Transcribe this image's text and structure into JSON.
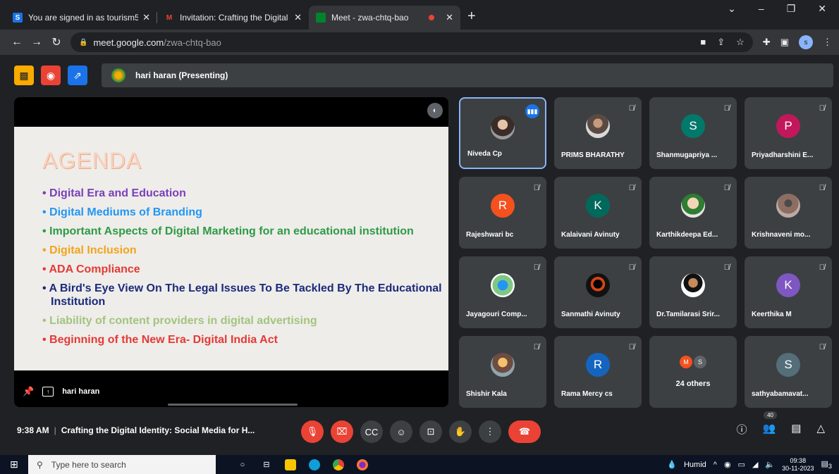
{
  "browser": {
    "tabs": [
      {
        "title": "You are signed in as tourism5",
        "favicon": "S",
        "favicon_color": "#1a73e8"
      },
      {
        "title": "Invitation: Crafting the Digital Id",
        "favicon": "M",
        "favicon_color": "#ea4335"
      },
      {
        "title": "Meet - zwa-chtq-bao",
        "favicon": "meet",
        "favicon_color": "#00832d"
      }
    ],
    "url_host": "meet.google.com",
    "url_path": "/zwa-chtq-bao",
    "profile_initial": "s"
  },
  "meet": {
    "presenter_label": "hari haran (Presenting)",
    "presenter_name": "hari haran",
    "slide": {
      "title": "AGENDA",
      "items": [
        {
          "text": "Digital Era and Education",
          "color": "#7b3fb8"
        },
        {
          "text": "Digital Mediums of Branding",
          "color": "#2196f3"
        },
        {
          "text": "Important Aspects of Digital Marketing for an educational institution",
          "color": "#2e9a45"
        },
        {
          "text": "Digital Inclusion",
          "color": "#f2a41a"
        },
        {
          "text": "ADA Compliance",
          "color": "#e53935"
        },
        {
          "text": "A Bird's Eye View On The Legal Issues To Be Tackled By The Educational Institution",
          "color": "#1b2a7a"
        },
        {
          "text": "Liability of content providers in digital advertising",
          "color": "#a3c47d"
        },
        {
          "text": "Beginning of the New Era- Digital India Act",
          "color": "#e53935"
        }
      ]
    },
    "participants": [
      {
        "name": "Niveda Cp",
        "avatar": "photo",
        "color": "",
        "speaking": true
      },
      {
        "name": "PRIMS BHARATHY",
        "avatar": "photo2",
        "color": ""
      },
      {
        "name": "Shanmugapriya ...",
        "avatar": "S",
        "color": "#00796b"
      },
      {
        "name": "Priyadharshini E...",
        "avatar": "P",
        "color": "#c2185b"
      },
      {
        "name": "Rajeshwari bc",
        "avatar": "R",
        "color": "#f4511e"
      },
      {
        "name": "Kalaivani Avinuty",
        "avatar": "K",
        "color": "#00695c"
      },
      {
        "name": "Karthikdeepa Ed...",
        "avatar": "photo3",
        "color": ""
      },
      {
        "name": "Krishnaveni mo...",
        "avatar": "photo7",
        "color": ""
      },
      {
        "name": "Jayagouri Comp...",
        "avatar": "photo4",
        "color": ""
      },
      {
        "name": "Sanmathi Avinuty",
        "avatar": "photo5",
        "color": ""
      },
      {
        "name": "Dr.Tamilarasi Srir...",
        "avatar": "photo6",
        "color": ""
      },
      {
        "name": "Keerthika M",
        "avatar": "K",
        "color": "#7e57c2"
      },
      {
        "name": "Shishir Kala",
        "avatar": "photo8",
        "color": ""
      },
      {
        "name": "Rama Mercy cs",
        "avatar": "R",
        "color": "#1565c0"
      },
      {
        "name": "24 others",
        "avatar": "others",
        "color": ""
      },
      {
        "name": "sathyabamavat...",
        "avatar": "S",
        "color": "#546e7a"
      }
    ],
    "others_initials": [
      {
        "letter": "M",
        "color": "#f4511e"
      },
      {
        "letter": "S",
        "color": "#5f6368"
      }
    ],
    "time": "9:38 AM",
    "meeting_title": "Crafting the Digital Identity: Social Media for H...",
    "participant_count": "40"
  },
  "taskbar": {
    "search_placeholder": "Type here to search",
    "weather": "Humid",
    "time": "09:38",
    "date": "30-11-2023",
    "notification_count": "3"
  }
}
